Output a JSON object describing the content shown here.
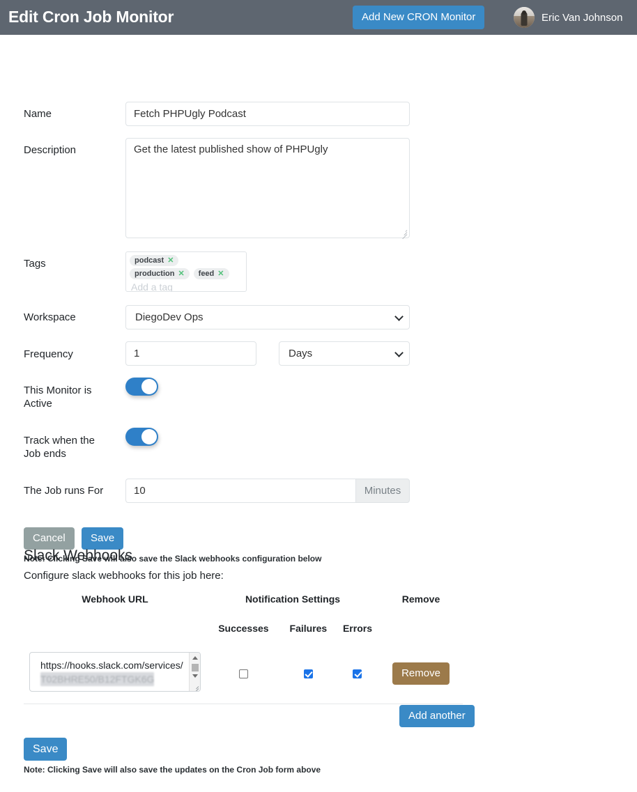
{
  "header": {
    "title": "Edit Cron Job Monitor",
    "cta_label": "Add New CRON Monitor",
    "user_name": "Eric Van Johnson",
    "bg_color": "#5e6670",
    "accent_color": "#3a8ac6"
  },
  "form": {
    "name": {
      "label": "Name",
      "value": "Fetch PHPUgly Podcast"
    },
    "description": {
      "label": "Description",
      "value": "Get the latest published show of PHPUgly"
    },
    "tags": {
      "label": "Tags",
      "items": [
        "podcast",
        "production",
        "feed"
      ],
      "remove_glyph": "✕",
      "placeholder": "Add a tag"
    },
    "workspace": {
      "label": "Workspace",
      "value": "DiegoDev Ops"
    },
    "frequency": {
      "label": "Frequency",
      "value": "1",
      "unit": "Days"
    },
    "active": {
      "label": "This Monitor is Active",
      "state": "on"
    },
    "track_end": {
      "label": "Track when the Job ends",
      "state": "on"
    },
    "runs_for": {
      "label": "The Job runs For",
      "value": "10",
      "unit": "Minutes"
    },
    "cancel_label": "Cancel",
    "save_label": "Save",
    "note": "Note: Clicking Save will also save the Slack webhooks configuration below"
  },
  "webhooks": {
    "title": "Slack Webhooks",
    "subtitle": "Configure slack webhooks for this job here:",
    "columns": {
      "url": "Webhook URL",
      "notification": "Notification Settings",
      "remove": "Remove",
      "successes": "Successes",
      "failures": "Failures",
      "errors": "Errors"
    },
    "rows": [
      {
        "url_visible": "https://hooks.slack.com/services/",
        "url_redacted": "T02BHRE50/B12FTGK6G",
        "successes_checked": false,
        "failures_checked": true,
        "errors_checked": true,
        "remove_label": "Remove"
      }
    ],
    "add_another_label": "Add another",
    "save_label": "Save",
    "note": "Note: Clicking Save will also save the updates on the Cron Job form above",
    "remove_button_color": "#9c7a4a"
  }
}
